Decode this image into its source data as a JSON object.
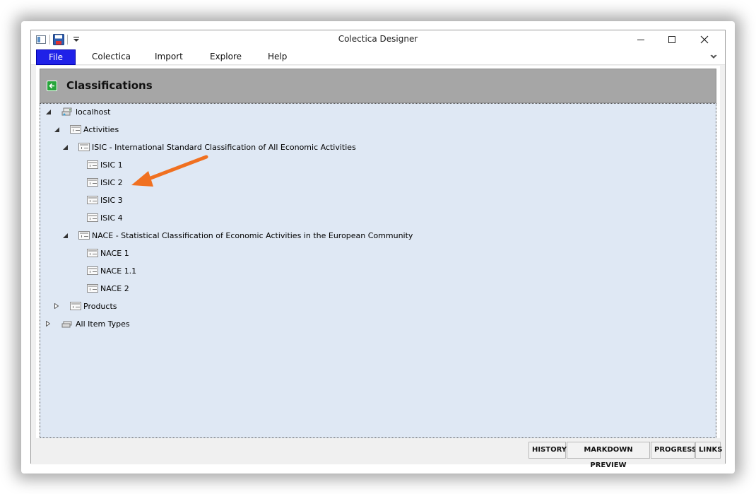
{
  "window": {
    "title": "Colectica Designer"
  },
  "menu": {
    "items": [
      "File",
      "Colectica",
      "Import",
      "Explore",
      "Help"
    ]
  },
  "header": {
    "title": "Classifications"
  },
  "tree": {
    "root": "localhost",
    "activities": "Activities",
    "isic": "ISIC - International Standard Classification of All Economic Activities",
    "isic_items": [
      "ISIC 1",
      "ISIC 2",
      "ISIC 3",
      "ISIC 4"
    ],
    "nace": "NACE - Statistical Classification of Economic Activities in the European Community",
    "nace_items": [
      "NACE 1",
      "NACE 1.1",
      "NACE 2"
    ],
    "products": "Products",
    "all_item_types": "All Item Types"
  },
  "bottom_tabs": [
    "HISTORY",
    "MARKDOWN PREVIEW",
    "PROGRESS",
    "LINKS"
  ],
  "icons": {
    "app": "app-icon",
    "save": "save-icon",
    "qat_dropdown": "chevron-down-icon",
    "minimize": "minimize-icon",
    "maximize": "maximize-icon",
    "close": "close-icon",
    "back": "back-arrow-icon",
    "expanded": "triangle-down-icon",
    "collapsed": "triangle-right-icon",
    "server": "server-icon",
    "document": "document-icon"
  },
  "colors": {
    "file_tab": "#1f21e8",
    "header_bg": "#a6a6a6",
    "tree_bg": "#dfe8f4",
    "back_button": "#27a53b",
    "annotation_arrow": "#f07020"
  }
}
